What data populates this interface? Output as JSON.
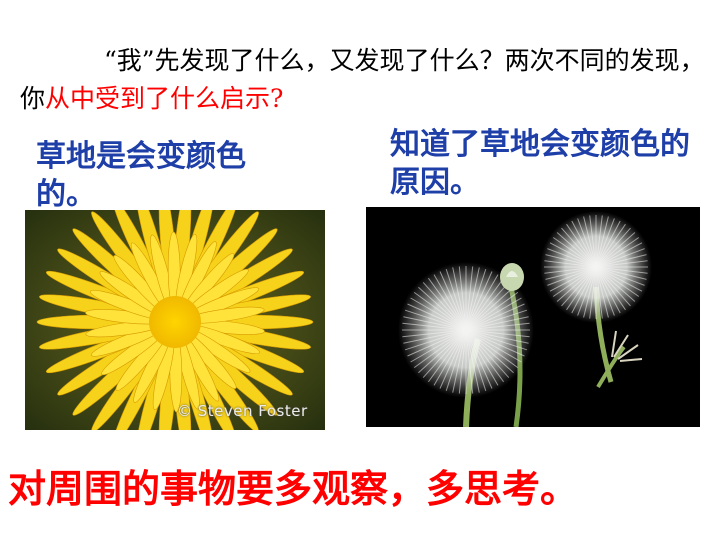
{
  "question": {
    "black_part": "“我”先发现了什么，又发现了什么？两次不同的发现，你",
    "red_part": "从中受到了什么启示?"
  },
  "captions": {
    "left": "草地是会变颜色的。",
    "right": "知道了草地会变颜色的原因。"
  },
  "photos": {
    "left_credit": "© Steven Foster",
    "left_subject": "yellow-dandelion-flower",
    "right_subject": "dandelion-seed-heads"
  },
  "conclusion": "对周围的事物要多观察，多思考。",
  "colors": {
    "background": "#ffffff",
    "caption_blue": "#1f3fa8",
    "emphasis_red": "#ff0000"
  }
}
